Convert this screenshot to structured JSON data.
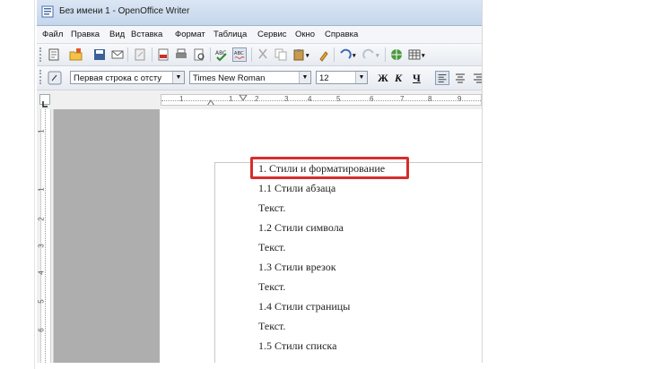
{
  "window": {
    "title": "Без имени 1 - OpenOffice Writer"
  },
  "menu": [
    "Файл",
    "Правка",
    "Вид",
    "Вставка",
    "Формат",
    "Таблица",
    "Сервис",
    "Окно",
    "Справка"
  ],
  "format_toolbar": {
    "paragraph_style": "Первая строка с отсту",
    "font_name": "Times New Roman",
    "font_size": "12",
    "bold_label": "Ж",
    "italic_label": "К",
    "underline_label": "Ч"
  },
  "ruler": {
    "labels": [
      "1",
      "1",
      "2",
      "3",
      "4",
      "5",
      "6",
      "7",
      "8",
      "9"
    ]
  },
  "vertical_ruler": {
    "labels": [
      "1",
      "1",
      "2",
      "3",
      "4",
      "5",
      "6"
    ]
  },
  "document": {
    "lines": [
      "1. Стили и форматирование",
      "1.1 Стили абзаца",
      "Текст.",
      "1.2 Стили символа",
      "Текст.",
      "1.3 Стили врезок",
      "Текст.",
      "1.4 Стили страницы",
      "Текст.",
      "1.5 Стили списка"
    ]
  },
  "colors": {
    "highlight": "#d62d2d",
    "gray_panel": "#aeaeae"
  }
}
